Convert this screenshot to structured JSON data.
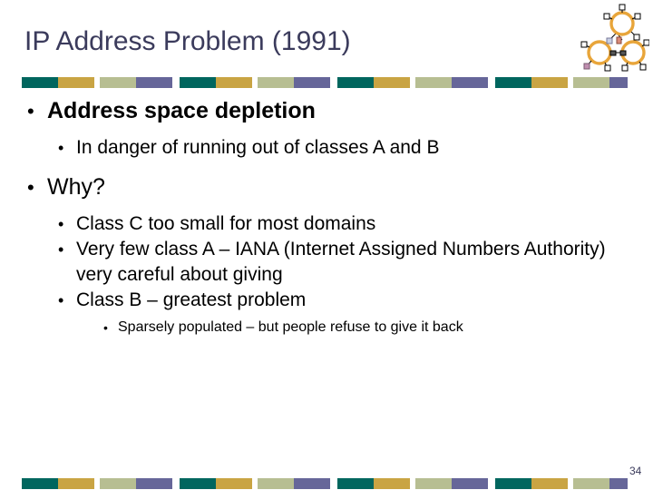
{
  "slide": {
    "title": "IP Address Problem (1991)",
    "title_color": "#3b3b5c",
    "background_color": "#ffffff",
    "page_number": "34",
    "decoration": {
      "name": "molecule-graphic",
      "ring_color": "#e8a53a",
      "handle_color": "#ffffff",
      "handle_border": "#000000",
      "accent_colors": [
        "#c08fb0",
        "#b8c4dd"
      ]
    },
    "color_bar": {
      "colors": {
        "teal": "#00665e",
        "gold": "#c9a443",
        "sage": "#b7be92",
        "slate": "#666699"
      },
      "repeat_count": 4
    },
    "bullets": [
      {
        "level": 1,
        "marker": "•",
        "text": "Address space depletion",
        "bold": true
      },
      {
        "level": 2,
        "marker": "•",
        "text": "In danger of running out of classes A and B",
        "bold": false
      },
      {
        "level": 1,
        "marker": "•",
        "text": "Why?",
        "bold": false
      },
      {
        "level": 2,
        "marker": "•",
        "text": "Class C too small for most domains",
        "bold": false
      },
      {
        "level": 2,
        "marker": "•",
        "text": "Very few class A – IANA (Internet Assigned Numbers Authority) very careful about giving",
        "bold": false
      },
      {
        "level": 2,
        "marker": "•",
        "text": "Class B – greatest problem",
        "bold": false
      },
      {
        "level": 3,
        "marker": "•",
        "text": "Sparsely populated – but people refuse to give it back",
        "bold": false
      }
    ]
  }
}
